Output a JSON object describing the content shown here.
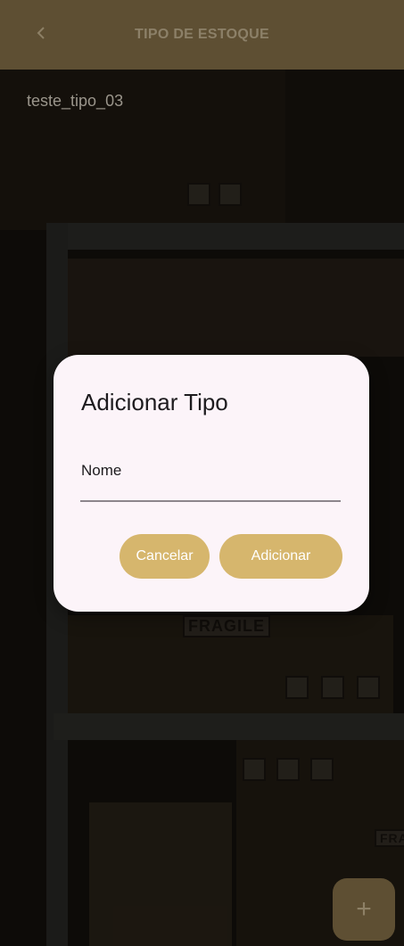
{
  "app_bar": {
    "title": "TIPO DE ESTOQUE",
    "back_icon": "chevron-left"
  },
  "list": {
    "items": [
      "teste_tipo_03"
    ]
  },
  "dialog": {
    "title": "Adicionar Tipo",
    "field_label": "Nome",
    "field_value": "",
    "cancel_label": "Cancelar",
    "add_label": "Adicionar"
  },
  "background": {
    "fragile_label": "FRAGILE",
    "fragile_label_2": "FRA"
  },
  "fab": {
    "icon": "plus"
  },
  "colors": {
    "app_bar": "#5e4f33",
    "dialog_bg": "#fcf4f9",
    "button": "#d6b66d",
    "button_text": "#ffffff"
  }
}
